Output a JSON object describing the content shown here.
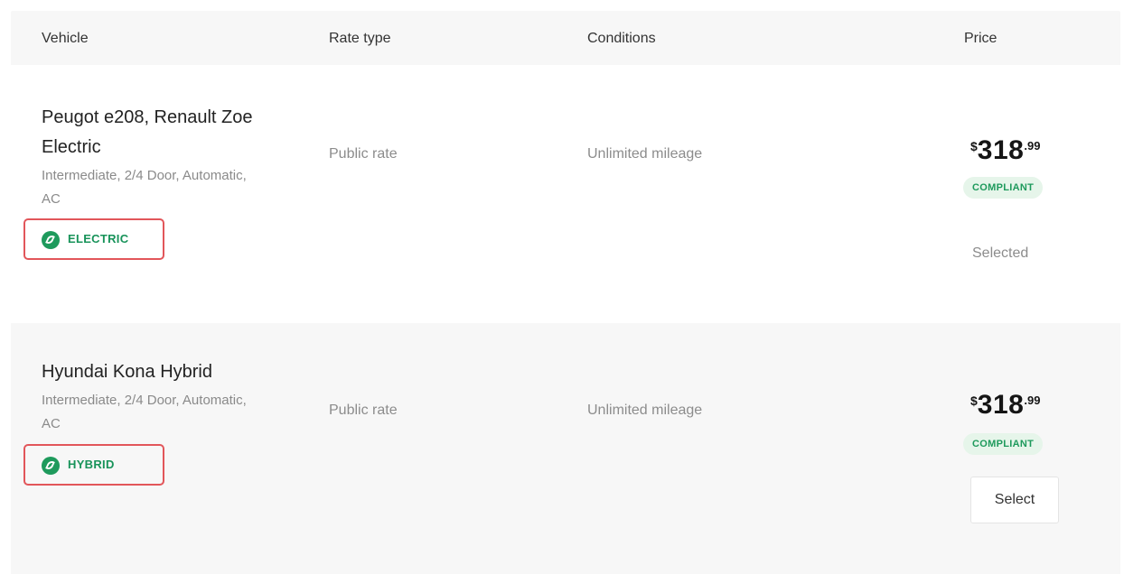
{
  "header": {
    "vehicle": "Vehicle",
    "rate_type": "Rate type",
    "conditions": "Conditions",
    "price": "Price"
  },
  "rows": [
    {
      "name": "Peugot e208, Renault Zoe Electric",
      "description": "Intermediate, 2/4 Door, Automatic, AC",
      "badge": "ELECTRIC",
      "badge_icon": "leaf-icon",
      "rate_type": "Public rate",
      "conditions": "Unlimited mileage",
      "currency": "$",
      "price_whole": "318",
      "price_cents": ".99",
      "compliance": "COMPLIANT",
      "action": "Selected"
    },
    {
      "name": "Hyundai Kona Hybrid",
      "description": "Intermediate, 2/4 Door, Automatic, AC",
      "badge": "HYBRID",
      "badge_icon": "leaf-icon",
      "rate_type": "Public rate",
      "conditions": "Unlimited mileage",
      "currency": "$",
      "price_whole": "318",
      "price_cents": ".99",
      "compliance": "COMPLIANT",
      "action": "Select"
    }
  ],
  "colors": {
    "accent_green": "#1e9a5c",
    "highlight_red": "#e2565a",
    "row_alt_bg": "#f7f7f7"
  }
}
